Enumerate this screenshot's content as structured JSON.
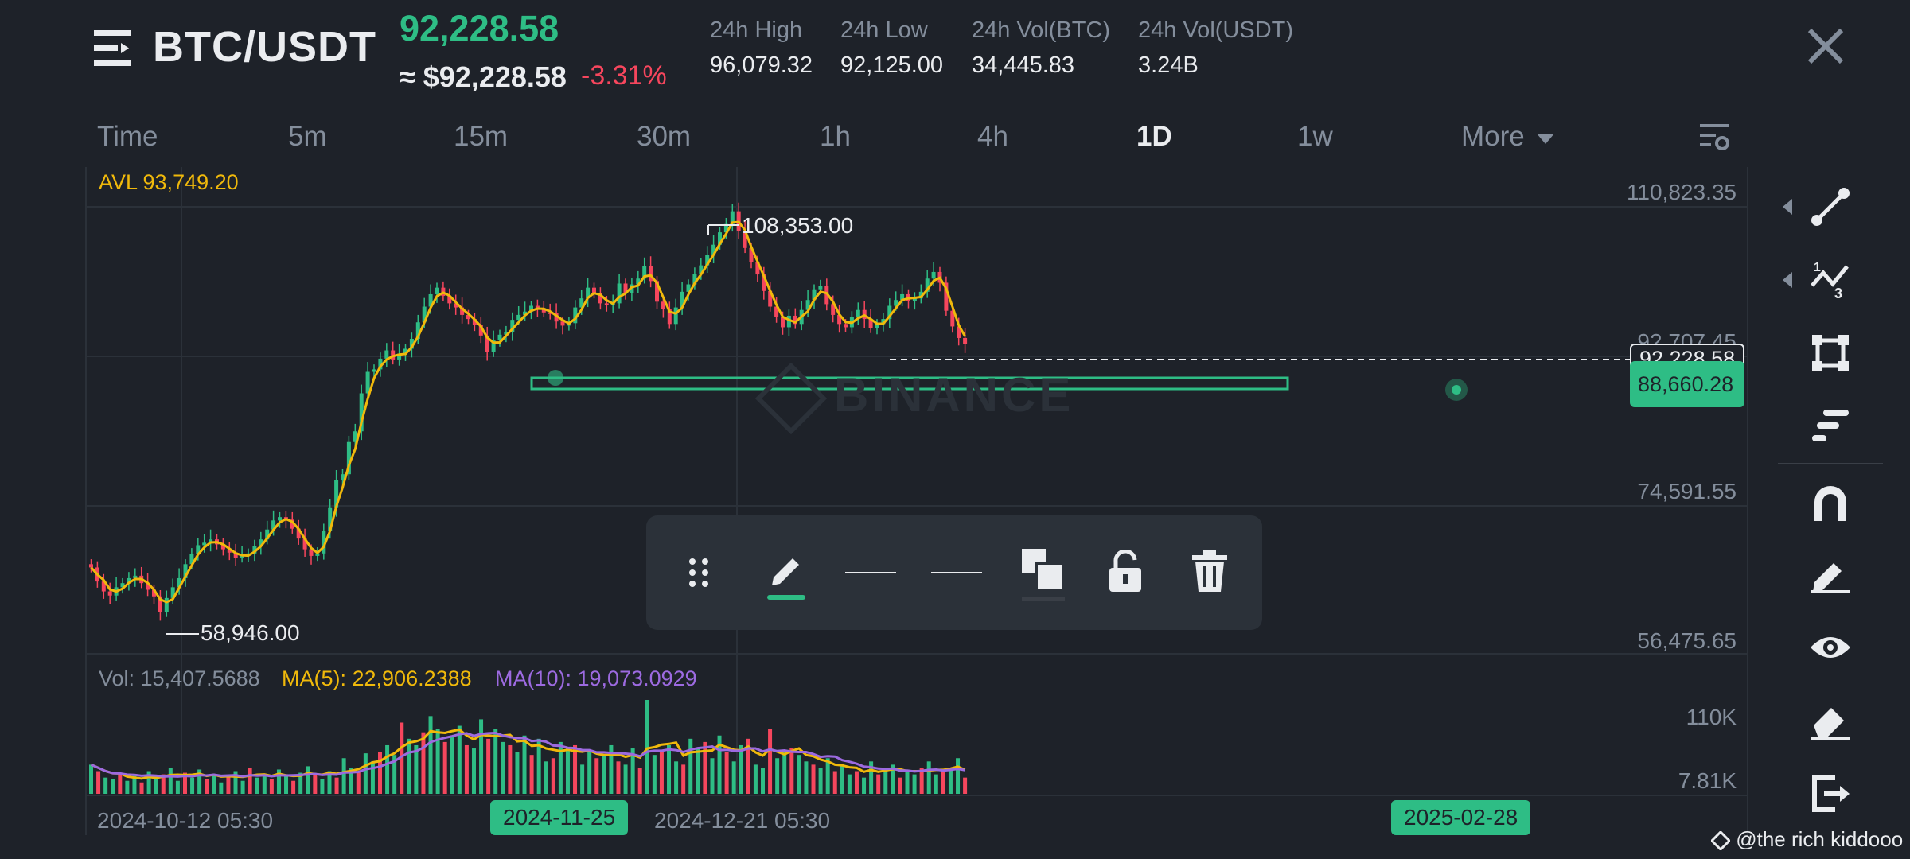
{
  "header": {
    "pair": "BTC/USDT",
    "last_price": "92,228.58",
    "fiat_price": "≈ $92,228.58",
    "change": "-3.31%",
    "stats": [
      {
        "label": "24h High",
        "value": "96,079.32"
      },
      {
        "label": "24h Low",
        "value": "92,125.00"
      },
      {
        "label": "24h Vol(BTC)",
        "value": "34,445.83"
      },
      {
        "label": "24h Vol(USDT)",
        "value": "3.24B"
      }
    ]
  },
  "timeframes": [
    {
      "label": "Time",
      "active": false
    },
    {
      "label": "5m",
      "active": false
    },
    {
      "label": "15m",
      "active": false
    },
    {
      "label": "30m",
      "active": false
    },
    {
      "label": "1h",
      "active": false
    },
    {
      "label": "4h",
      "active": false
    },
    {
      "label": "1D",
      "active": true
    },
    {
      "label": "1w",
      "active": false
    },
    {
      "label": "More",
      "active": false
    }
  ],
  "chart": {
    "avl": "AVL 93,749.20",
    "y_labels": [
      "110,823.35",
      "92,707.45",
      "74,591.55",
      "56,475.65"
    ],
    "current_price_tag": "92,228.58",
    "line_price_tag": "88,660.28",
    "max_annotation": "108,353.00",
    "min_annotation": "58,946.00",
    "watermark": "BINANCE",
    "vol": "Vol: 15,407.5688",
    "ma5": "MA(5): 22,906.2388",
    "ma10": "MA(10): 19,073.0929",
    "vol_y_labels": [
      "110K",
      "7.81K"
    ],
    "x_labels": [
      "2024-10-12 05:30",
      "2024-12-21 05:30"
    ],
    "date_pills": [
      "2024-11-25",
      "2025-02-28"
    ]
  },
  "chart_data": {
    "type": "candlestick",
    "interval": "1D",
    "ylim": [
      56475.65,
      110823.35
    ],
    "closes": [
      65200,
      63500,
      62300,
      61800,
      62800,
      63300,
      63900,
      64200,
      63300,
      62500,
      61700,
      59800,
      61500,
      62800,
      63900,
      65600,
      66800,
      67900,
      68200,
      68600,
      68000,
      67400,
      67000,
      66400,
      66600,
      66900,
      67800,
      68600,
      69800,
      70900,
      71300,
      71000,
      69900,
      68700,
      67400,
      66600,
      66900,
      69600,
      72400,
      75800,
      76500,
      80400,
      81700,
      86300,
      88900,
      89200,
      90500,
      91500,
      90400,
      91100,
      91700,
      92900,
      94900,
      96800,
      98300,
      99100,
      98100,
      97200,
      96700,
      95800,
      95300,
      94600,
      93300,
      91300,
      92700,
      93400,
      93700,
      95200,
      95800,
      96200,
      96900,
      96600,
      96100,
      96000,
      95000,
      94500,
      94800,
      96700,
      97800,
      99100,
      98400,
      97200,
      97100,
      97200,
      99600,
      98400,
      99500,
      100200,
      101700,
      99900,
      97400,
      96500,
      94700,
      96700,
      98600,
      99500,
      100800,
      101800,
      103100,
      104300,
      105800,
      106800,
      108353,
      106000,
      103900,
      102200,
      100700,
      98700,
      96800,
      95600,
      94300,
      95700,
      94700,
      96400,
      97600,
      98900,
      99300,
      97100,
      95800,
      94700,
      94300,
      95500,
      96400,
      95300,
      94200,
      94700,
      95300,
      96900,
      97600,
      98300,
      97500,
      97800,
      98600,
      100200,
      101000,
      99700,
      96300,
      94400,
      93000,
      92228
    ]
  },
  "volume_data": {
    "ylim": [
      0,
      110000
    ],
    "values": [
      18,
      14,
      10,
      9,
      12,
      8,
      11,
      7,
      14,
      9,
      12,
      16,
      8,
      13,
      10,
      15,
      9,
      12,
      7,
      11,
      14,
      8,
      16,
      10,
      12,
      9,
      15,
      11,
      8,
      13,
      17,
      12,
      9,
      14,
      10,
      22,
      16,
      14,
      25,
      20,
      26,
      30,
      24,
      44,
      34,
      30,
      38,
      48,
      40,
      32,
      36,
      42,
      30,
      28,
      46,
      34,
      40,
      32,
      30,
      26,
      36,
      24,
      34,
      20,
      22,
      32,
      28,
      30,
      18,
      26,
      22,
      24,
      30,
      20,
      18,
      28,
      16,
      58,
      24,
      26,
      30,
      20,
      18,
      34,
      28,
      32,
      22,
      36,
      26,
      20,
      30,
      34,
      18,
      16,
      40,
      22,
      26,
      28,
      24,
      20,
      18,
      16,
      22,
      14,
      18,
      12,
      14,
      10,
      20,
      12,
      16,
      18,
      10,
      14,
      12,
      16,
      20,
      12,
      14,
      16,
      22,
      10
    ]
  },
  "drawing_toolbar": {
    "items": [
      "drag-handle",
      "edit",
      "line-style",
      "line-width",
      "color",
      "lock",
      "delete"
    ]
  },
  "sidebar_tools": [
    "trend-line-icon",
    "fib-icon",
    "rectangle-icon",
    "position-icon",
    "magnet-icon",
    "pencil-icon",
    "eye-icon",
    "eraser-icon",
    "exit-icon"
  ],
  "credit": "@the rich kiddooo",
  "colors": {
    "up": "#2ebd85",
    "down": "#f6465d",
    "ma5": "#f0b90b",
    "ma10": "#9c6ae0",
    "bg": "#1e2229"
  }
}
